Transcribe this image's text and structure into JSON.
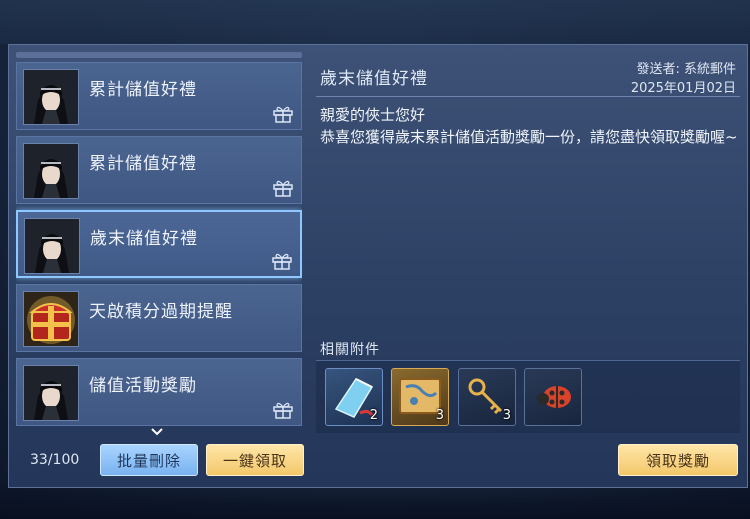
{
  "mail_list": {
    "items": [
      {
        "title": "累計儲值好禮",
        "icon": "avatar-warrior",
        "has_gift": true,
        "selected": false
      },
      {
        "title": "累計儲值好禮",
        "icon": "avatar-warrior",
        "has_gift": true,
        "selected": false
      },
      {
        "title": "歲末儲值好禮",
        "icon": "avatar-warrior",
        "has_gift": true,
        "selected": true
      },
      {
        "title": "天啟積分過期提醒",
        "icon": "treasure-chest",
        "has_gift": false,
        "selected": false
      },
      {
        "title": "儲值活動獎勵",
        "icon": "avatar-warrior",
        "has_gift": true,
        "selected": false
      }
    ],
    "count": "33/100"
  },
  "buttons": {
    "batch_delete": "批量刪除",
    "claim_all": "一鍵領取",
    "claim_reward": "領取獎勵"
  },
  "detail": {
    "title": "歲末儲值好禮",
    "sender": "發送者: 系統郵件",
    "date": "2025年01月02日",
    "greeting": "親愛的俠士您好",
    "message": "恭喜您獲得歲末累計儲值活動獎勵一份，請您盡快領取獎勵喔~"
  },
  "attachments": {
    "label": "相關附件",
    "items": [
      {
        "icon": "blue-scroll-icon",
        "qty": "2"
      },
      {
        "icon": "treasure-map-icon",
        "qty": "3"
      },
      {
        "icon": "golden-key-icon",
        "qty": "3"
      },
      {
        "icon": "ladybug-icon",
        "qty": ""
      }
    ]
  },
  "colors": {
    "accent_blue": "#8fc7ff",
    "gold_button": "#f3c86a",
    "panel": "#3e5277"
  }
}
